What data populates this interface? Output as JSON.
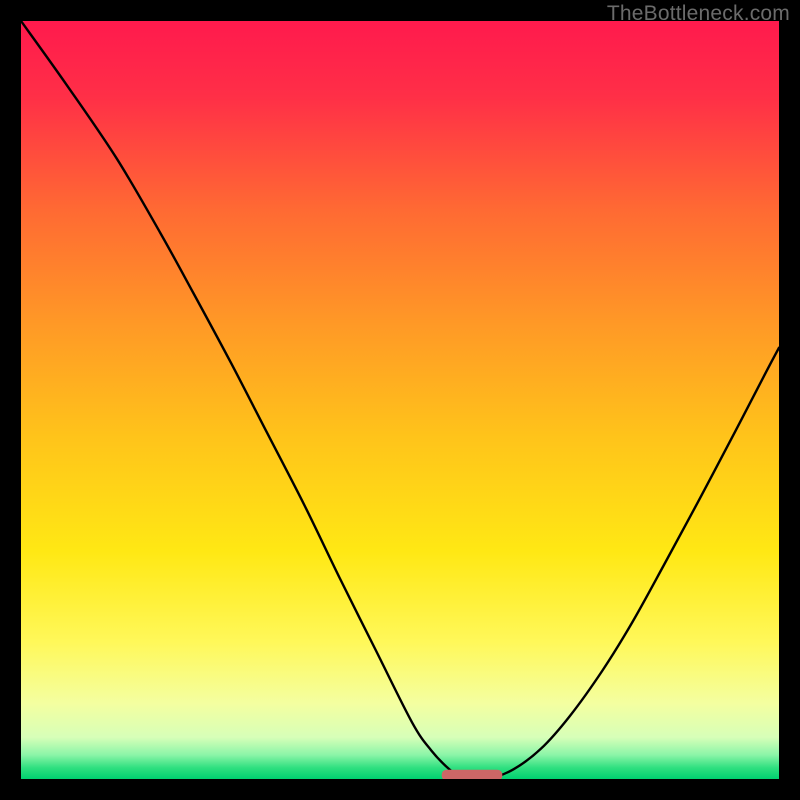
{
  "watermark": {
    "text": "TheBottleneck.com"
  },
  "chart_data": {
    "type": "line",
    "title": "",
    "xlabel": "",
    "ylabel": "",
    "xlim": [
      0,
      100
    ],
    "ylim": [
      0,
      100
    ],
    "grid": false,
    "background": "red-yellow-green vertical gradient",
    "series": [
      {
        "name": "curve",
        "x": [
          0,
          6,
          12.6,
          18.4,
          22.8,
          27.7,
          32.4,
          37.4,
          42.1,
          46.8,
          51.6,
          54.1,
          56.6,
          58.5,
          61.6,
          65,
          68.6,
          72.4,
          76.7,
          80.6,
          84.8,
          89.5,
          94.2,
          98.3,
          100
        ],
        "y": [
          100,
          91.6,
          81.9,
          72,
          64,
          54.9,
          45.8,
          36.1,
          26.4,
          17.0,
          7.45,
          3.8,
          1.2,
          0,
          0,
          1.3,
          4.0,
          8.3,
          14.3,
          20.6,
          28.2,
          36.9,
          45.8,
          53.7,
          56.9
        ]
      }
    ],
    "marker": {
      "shape": "rounded-bar",
      "color": "#cc6666",
      "x_range": [
        55.5,
        63.5
      ],
      "y": 0.5
    }
  },
  "colors": {
    "gradient_stops": [
      {
        "offset": 0,
        "color": "#ff1a4d"
      },
      {
        "offset": 0.1,
        "color": "#ff2f47"
      },
      {
        "offset": 0.25,
        "color": "#ff6a33"
      },
      {
        "offset": 0.4,
        "color": "#ff9926"
      },
      {
        "offset": 0.55,
        "color": "#ffc41a"
      },
      {
        "offset": 0.7,
        "color": "#ffe814"
      },
      {
        "offset": 0.82,
        "color": "#fff85a"
      },
      {
        "offset": 0.9,
        "color": "#f4ffa0"
      },
      {
        "offset": 0.945,
        "color": "#d7ffb8"
      },
      {
        "offset": 0.968,
        "color": "#8cf5a8"
      },
      {
        "offset": 0.985,
        "color": "#30e080"
      },
      {
        "offset": 1.0,
        "color": "#00d070"
      }
    ],
    "curve_stroke": "#000000",
    "marker_fill": "#cc6666"
  }
}
